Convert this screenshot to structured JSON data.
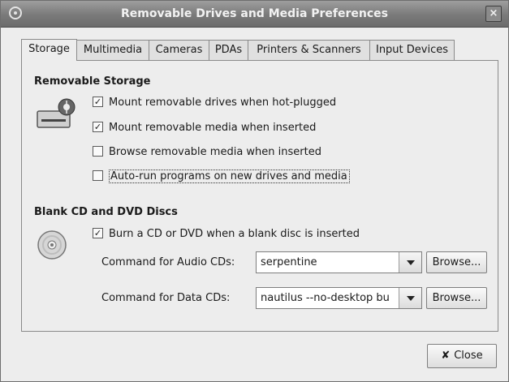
{
  "window": {
    "title": "Removable Drives and Media Preferences",
    "close_glyph": "×"
  },
  "tabs": [
    "Storage",
    "Multimedia",
    "Cameras",
    "PDAs",
    "Printers & Scanners",
    "Input Devices"
  ],
  "storage": {
    "title": "Removable Storage",
    "options": [
      {
        "label": "Mount removable drives when hot-plugged",
        "checked": true
      },
      {
        "label": "Mount removable media when inserted",
        "checked": true
      },
      {
        "label": "Browse removable media when inserted",
        "checked": false
      },
      {
        "label": "Auto-run programs on new drives and media",
        "checked": false
      }
    ]
  },
  "discs": {
    "title": "Blank CD and DVD Discs",
    "burn_label": "Burn a CD or DVD when a blank disc is inserted",
    "burn_checked": true,
    "audio_label": "Command for Audio CDs:",
    "audio_value": "serpentine",
    "data_label": "Command for Data CDs:",
    "data_value": "nautilus --no-desktop bu",
    "browse_label": "Browse..."
  },
  "footer": {
    "close_label": "Close",
    "close_icon_glyph": "✘"
  },
  "icons": {
    "checked_glyph": "✓"
  }
}
